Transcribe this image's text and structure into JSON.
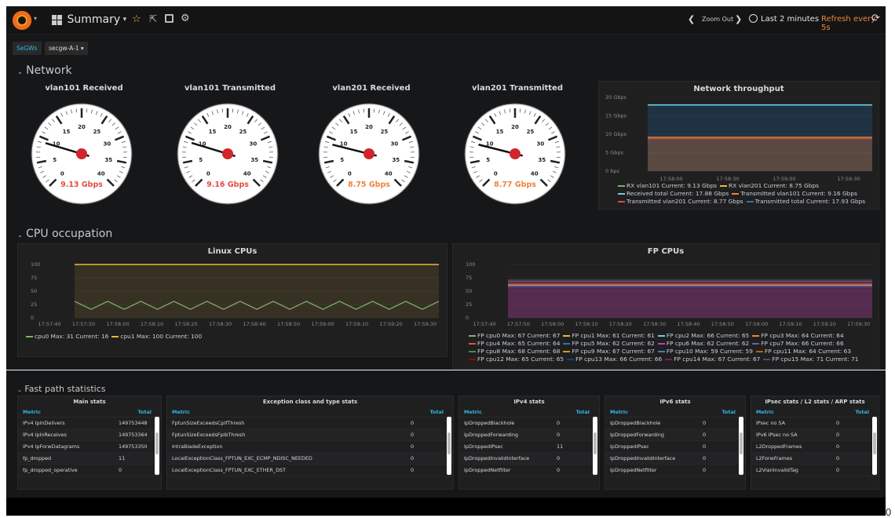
{
  "nav": {
    "dashboard_title": "Summary",
    "zoom_out": "Zoom Out",
    "time_range": "Last 2 minutes",
    "refresh": "Refresh every 5s"
  },
  "vars": {
    "label": "SeGWs",
    "value": "secgw-A-1"
  },
  "rows": {
    "network": "Network",
    "cpu": "CPU occupation",
    "fastpath": "Fast path statistics"
  },
  "gauges": [
    {
      "title": "vlan101 Received",
      "value": "9.13 Gbps",
      "reading": 9.13,
      "color": "#e24d42"
    },
    {
      "title": "vlan101 Transmitted",
      "value": "9.16 Gbps",
      "reading": 9.16,
      "color": "#e24d42"
    },
    {
      "title": "vlan201 Received",
      "value": "8.75 Gbps",
      "reading": 8.75,
      "color": "#ef843c"
    },
    {
      "title": "vlan201 Transmitted",
      "value": "8.77 Gbps",
      "reading": 8.77,
      "color": "#ef843c"
    }
  ],
  "gauge_ticks": [
    "0",
    "5",
    "10",
    "15",
    "20",
    "25",
    "30",
    "35",
    "40"
  ],
  "net_chart": {
    "title": "Network throughput",
    "yticks": [
      "20 Gbps",
      "15 Gbps",
      "10 Gbps",
      "5 Gbps",
      "0 bps"
    ],
    "xticks": [
      "17:58:00",
      "17:58:30",
      "17:59:00",
      "17:59:30"
    ],
    "legend": [
      {
        "text": "RX vlan101 Current: 9.13 Gbps",
        "color": "#7eb26d"
      },
      {
        "text": "RX vlan201 Current: 8.75 Gbps",
        "color": "#eab839"
      },
      {
        "text": "Received total Current: 17.88 Gbps",
        "color": "#6ed0e0"
      },
      {
        "text": "Transmitted vlan101 Current: 9.16 Gbps",
        "color": "#ef843c"
      },
      {
        "text": "Transmitted vlan201 Current: 8.77 Gbps",
        "color": "#e24d42"
      },
      {
        "text": "Transmitted total Current: 17.93 Gbps",
        "color": "#1f78c1"
      }
    ]
  },
  "linux_chart": {
    "title": "Linux CPUs",
    "yticks": [
      "100",
      "75",
      "50",
      "25",
      "0"
    ],
    "xticks": [
      "17:57:40",
      "17:57:50",
      "17:58:00",
      "17:58:10",
      "17:58:20",
      "17:58:30",
      "17:58:40",
      "17:58:50",
      "17:59:00",
      "17:59:10",
      "17:59:20",
      "17:59:30"
    ],
    "legend": [
      {
        "text": "cpu0 Max: 31 Current: 16",
        "color": "#7eb26d"
      },
      {
        "text": "cpu1 Max: 100 Current: 100",
        "color": "#eab839"
      }
    ]
  },
  "fp_chart": {
    "title": "FP CPUs",
    "yticks": [
      "100",
      "75",
      "50",
      "25",
      "0"
    ],
    "xticks": [
      "17:57:40",
      "17:57:50",
      "17:58:00",
      "17:58:10",
      "17:58:20",
      "17:58:30",
      "17:58:40",
      "17:58:50",
      "17:59:00",
      "17:59:10",
      "17:59:20",
      "17:59:30"
    ],
    "legend_rows": [
      [
        {
          "text": "FP cpu0 Max: 67 Current: 67",
          "color": "#7eb26d"
        },
        {
          "text": "FP cpu1 Max: 61 Current: 61",
          "color": "#eab839"
        },
        {
          "text": "FP cpu2 Max: 66 Current: 65",
          "color": "#6ed0e0"
        },
        {
          "text": "FP cpu3 Max: 64 Current: 64",
          "color": "#ef843c"
        }
      ],
      [
        {
          "text": "FP cpu4 Max: 65 Current: 64",
          "color": "#e24d42"
        },
        {
          "text": "FP cpu5 Max: 62 Current: 62",
          "color": "#1f78c1"
        },
        {
          "text": "FP cpu6 Max: 62 Current: 62",
          "color": "#ba43a9"
        },
        {
          "text": "FP cpu7 Max: 66 Current: 66",
          "color": "#705da0"
        }
      ],
      [
        {
          "text": "FP cpu8 Max: 68 Current: 68",
          "color": "#508642"
        },
        {
          "text": "FP cpu9 Max: 67 Current: 67",
          "color": "#cca300"
        },
        {
          "text": "FP cpu10 Max: 59 Current: 59",
          "color": "#447ebc"
        },
        {
          "text": "FP cpu11 Max: 64 Current: 63",
          "color": "#c15c17"
        }
      ],
      [
        {
          "text": "FP cpu12 Max: 65 Current: 65",
          "color": "#890f02"
        },
        {
          "text": "FP cpu13 Max: 66 Current: 66",
          "color": "#0a437c"
        },
        {
          "text": "FP cpu14 Max: 67 Current: 67",
          "color": "#6d1f62"
        },
        {
          "text": "FP cpu15 Max: 71 Current: 71",
          "color": "#584477"
        }
      ]
    ]
  },
  "tables": [
    {
      "title": "Main stats",
      "cols": [
        "Metric",
        "Total"
      ],
      "rows": [
        [
          "IPv4 IpInDelivers",
          "149753448"
        ],
        [
          "IPv4 IpInReceives",
          "149753364"
        ],
        [
          "IPv4 IpForwDatagrams",
          "149753350"
        ],
        [
          "fp_dropped",
          "11"
        ],
        [
          "fp_dropped_operative",
          "0"
        ]
      ]
    },
    {
      "title": "Exception class and type stats",
      "cols": [
        "Metric",
        "Total"
      ],
      "rows": [
        [
          "FptunSizeExceedsCpIfThresh",
          "0"
        ],
        [
          "FptunSizeExceedsFpibThresh",
          "0"
        ],
        [
          "IntraBladeException",
          "0"
        ],
        [
          "LocalExceptionClass_FPTUN_EXC_ECMP_NDISC_NEEDED",
          "0"
        ],
        [
          "LocalExceptionClass_FPTUN_EXC_ETHER_DST",
          "0"
        ]
      ]
    },
    {
      "title": "IPv4 stats",
      "cols": [
        "Metric",
        "Total"
      ],
      "rows": [
        [
          "IpDroppedBlackhole",
          "0"
        ],
        [
          "IpDroppedForwarding",
          "0"
        ],
        [
          "IpDroppedIPsec",
          "11"
        ],
        [
          "IpDroppedInvalidInterface",
          "0"
        ],
        [
          "IpDroppedNetfilter",
          "0"
        ]
      ]
    },
    {
      "title": "IPv6 stats",
      "cols": [
        "Metric",
        "Total"
      ],
      "rows": [
        [
          "IpDroppedBlackhole",
          "0"
        ],
        [
          "IpDroppedForwarding",
          "0"
        ],
        [
          "IpDroppedIPsec",
          "0"
        ],
        [
          "IpDroppedInvalidInterface",
          "0"
        ],
        [
          "IpDroppedNetfilter",
          "0"
        ]
      ]
    },
    {
      "title": "IPsec stats / L2 stats / ARP stats",
      "cols": [
        "Metric",
        "Total"
      ],
      "rows": [
        [
          "IPsec no SA",
          "0"
        ],
        [
          "IPv6 IPsec no SA",
          "0"
        ],
        [
          "L2DroppedFrames",
          "0"
        ],
        [
          "L2ForwFrames",
          "0"
        ],
        [
          "L2VlanInvalidTag",
          "0"
        ]
      ]
    }
  ],
  "stray_char": "0"
}
